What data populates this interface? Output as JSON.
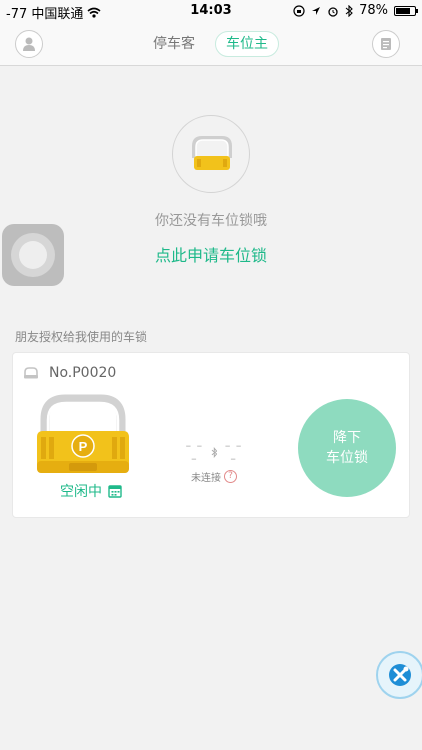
{
  "status_bar": {
    "carrier": "-77 中国联通",
    "time": "14:03",
    "battery": "78%",
    "battery_level": 0.78
  },
  "nav": {
    "tabs": [
      {
        "label": "停车客",
        "active": false
      },
      {
        "label": "车位主",
        "active": true
      }
    ],
    "left_icon": "user-avatar-icon",
    "right_icon": "document-icon"
  },
  "empty_state": {
    "message": "你还没有车位锁哦",
    "apply_link": "点此申请车位锁"
  },
  "shared_section": {
    "title": "朋友授权给我使用的车锁"
  },
  "lock_card": {
    "lock_number": "No.P0020",
    "status": "空闲中",
    "connection_status": "未连接",
    "help_mark": "?",
    "action_line1": "降下",
    "action_line2": "车位锁"
  },
  "colors": {
    "accent": "#1fb98a",
    "action_button": "#8edbbf",
    "lock_yellow": "#f2c21b"
  }
}
